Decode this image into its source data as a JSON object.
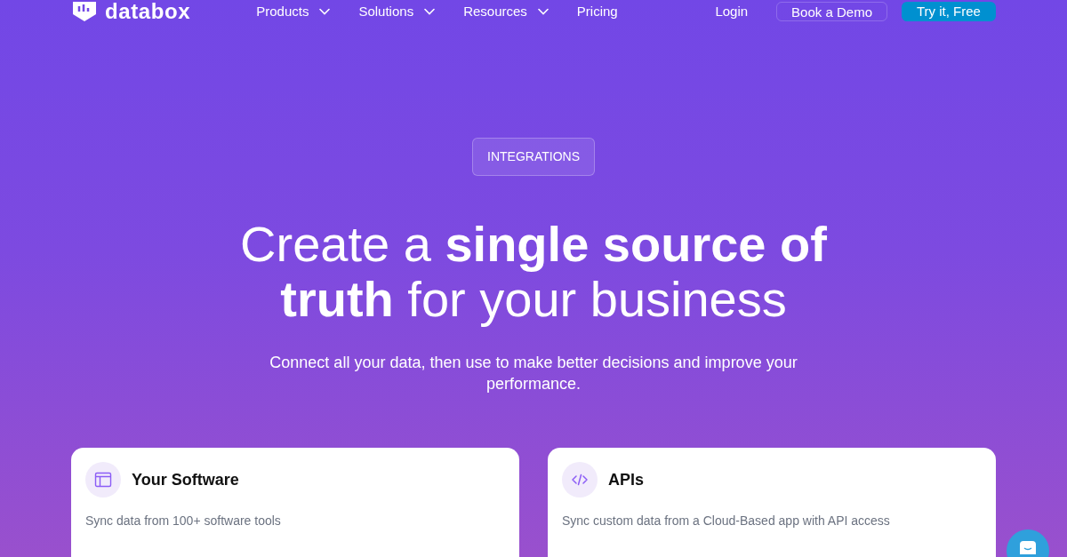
{
  "header": {
    "logo": "databox",
    "nav": [
      {
        "label": "Products",
        "dropdown": true
      },
      {
        "label": "Solutions",
        "dropdown": true
      },
      {
        "label": "Resources",
        "dropdown": true
      },
      {
        "label": "Pricing",
        "dropdown": false
      }
    ],
    "login": "Login",
    "demo_button": "Book a Demo",
    "cta_button": "Try it, Free"
  },
  "hero": {
    "badge": "INTEGRATIONS",
    "title": "Create a **single source of truth** for your business",
    "subtitle": "Connect all your data, then use to make better decisions and improve your performance."
  },
  "cards": [
    {
      "kind": "software",
      "title": "Your Software",
      "description": "Sync data from 100+ software tools"
    },
    {
      "kind": "api",
      "title": "APIs",
      "description": "Sync custom data from a Cloud-Based app with API access"
    }
  ]
}
